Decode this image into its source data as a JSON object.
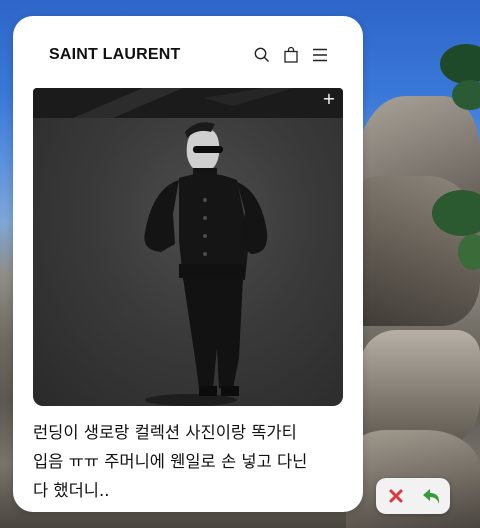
{
  "header": {
    "brand": "SAINT LAURENT",
    "icons": [
      "search-icon",
      "shopping-bag-icon",
      "hamburger-menu-icon"
    ]
  },
  "photo": {
    "overlay_icon": "plus-icon",
    "overlay_glyph": "+"
  },
  "caption": {
    "text": "런딩이 생로랑 컬렉션 사진이랑 똑가티\n입음 ㅠㅠ 주머니에 웬일로 손 넣고 다닌\n다 했더니.."
  },
  "actions": {
    "close_icon": "close-x-icon",
    "undo_icon": "undo-arrow-icon",
    "close_color": "#e0363a",
    "undo_color": "#3a9a3e"
  }
}
